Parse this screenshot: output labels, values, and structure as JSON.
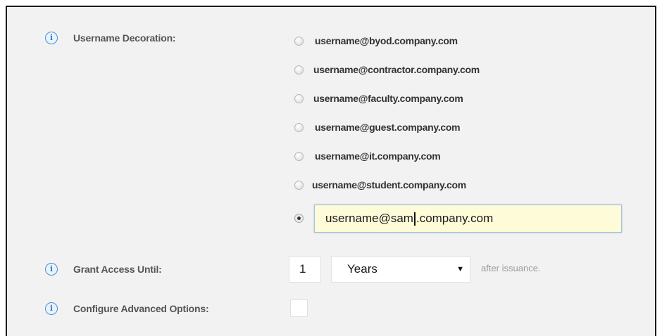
{
  "username_decoration": {
    "label": "Username Decoration:",
    "info_icon": "info-icon",
    "options": [
      {
        "label": "username@byod.company.com",
        "selected": false
      },
      {
        "label": "username@contractor.company.com",
        "selected": false
      },
      {
        "label": "username@faculty.company.com",
        "selected": false
      },
      {
        "label": "username@guest.company.com",
        "selected": false
      },
      {
        "label": "username@it.company.com",
        "selected": false
      },
      {
        "label": "username@student.company.com",
        "selected": false
      }
    ],
    "custom_selected": true,
    "custom_value_before_caret": "username@sam",
    "custom_value_after_caret": ".company.com"
  },
  "grant_access": {
    "label": "Grant Access Until:",
    "info_icon": "info-icon",
    "amount": "1",
    "unit": "Years",
    "suffix": "after issuance."
  },
  "advanced_options": {
    "label": "Configure Advanced Options:",
    "info_icon": "info-icon",
    "checked": false
  },
  "colors": {
    "panel_background": "#f2f2f2",
    "input_highlight": "#fefbd8",
    "info_icon_blue": "#2a7fd0"
  }
}
